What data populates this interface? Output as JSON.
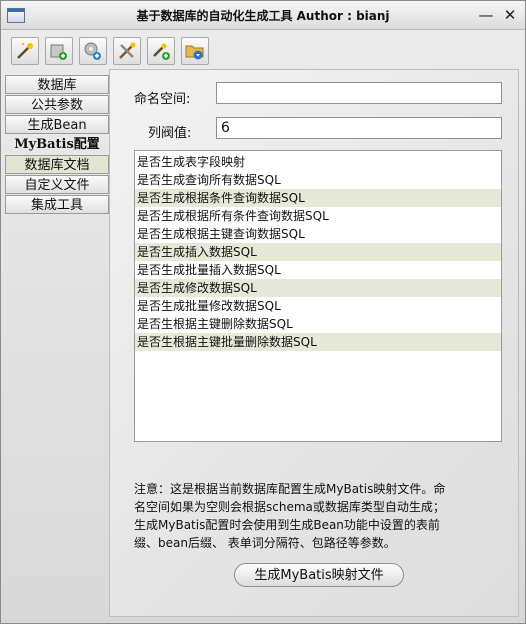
{
  "window": {
    "title": "基于数据库的自动化生成工具  Author : bianj",
    "minimize_glyph": "—",
    "close_glyph": "✕"
  },
  "toolbar": [
    {
      "icon": "wand-icon"
    },
    {
      "icon": "add-gear-icon"
    },
    {
      "icon": "gear-add-icon"
    },
    {
      "icon": "tools-icon"
    },
    {
      "icon": "wand-add-icon"
    },
    {
      "icon": "folder-download-icon"
    }
  ],
  "tabs": [
    {
      "label": "数据库"
    },
    {
      "label": "公共参数"
    },
    {
      "label": "生成Bean"
    },
    {
      "label": "MyBatis配置"
    },
    {
      "label": "数据库文档"
    },
    {
      "label": "自定义文件"
    },
    {
      "label": "集成工具"
    }
  ],
  "form": {
    "namespace_label": "命名空间:",
    "namespace_value": "",
    "threshold_label": "列阀值:",
    "threshold_value": "6"
  },
  "options": [
    "是否生成表字段映射",
    "是否生成查询所有数据SQL",
    "是否生成根据条件查询数据SQL",
    "是否生成根据所有条件查询数据SQL",
    "是否生成根据主键查询数据SQL",
    "是否生成插入数据SQL",
    "是否生成批量插入数据SQL",
    "是否生成修改数据SQL",
    "是否生成批量修改数据SQL",
    "是否生根据主键删除数据SQL",
    "是否生根据主键批量删除数据SQL"
  ],
  "note": {
    "line1": "注意：这是根据当前数据库配置生成MyBatis映射文件。命",
    "line2": "名空间如果为空则会根据schema或数据库类型自动生成；",
    "line3": "生成MyBatis配置时会使用到生成Bean功能中设置的表前",
    "line4": "缀、bean后缀、 表单词分隔符、包路径等参数。"
  },
  "generate_button": "生成MyBatis映射文件"
}
